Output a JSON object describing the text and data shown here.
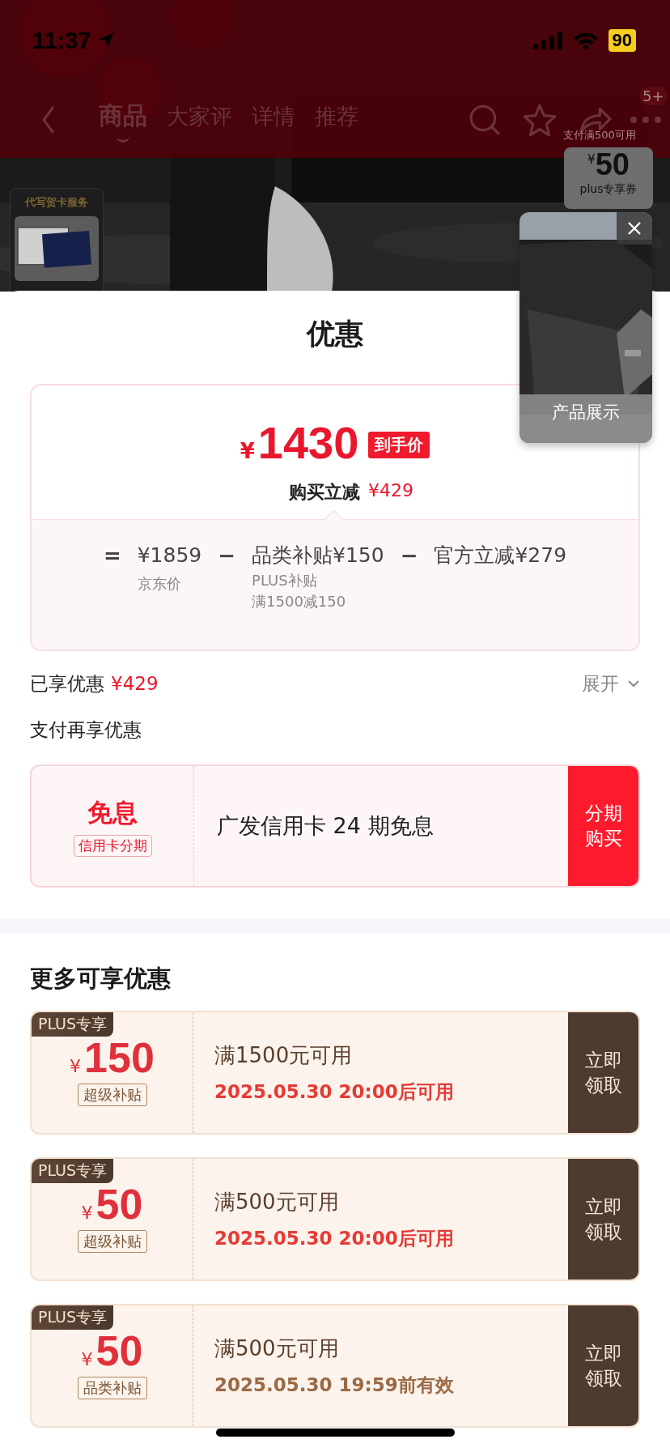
{
  "status_bar": {
    "time": "11:37",
    "battery": "90"
  },
  "nav": {
    "tabs": [
      {
        "label": "商品",
        "selected": true
      },
      {
        "label": "大家评",
        "selected": false
      },
      {
        "label": "详情",
        "selected": false
      },
      {
        "label": "推荐",
        "selected": false
      }
    ],
    "more_badge": "5+"
  },
  "side_promos": {
    "greeting_card": {
      "label": "代写贺卡服务"
    },
    "plus_coupon": {
      "note": "支付满500可用",
      "currency": "¥",
      "amount": "50",
      "label": "plus专享券"
    }
  },
  "video_popup": {
    "label": "产品展示"
  },
  "sheet": {
    "title": "优惠",
    "price_card": {
      "currency": "¥",
      "amount": "1430",
      "tag": "到手价",
      "saving_label": "购买立减",
      "saving_amount": "¥429",
      "breakdown": [
        {
          "kind": "operator",
          "text": "="
        },
        {
          "kind": "term",
          "value": "¥1859",
          "notes": [
            "京东价"
          ]
        },
        {
          "kind": "operator",
          "text": "−"
        },
        {
          "kind": "term",
          "value": "品类补贴¥150",
          "notes": [
            "PLUS补贴",
            "满1500减150"
          ]
        },
        {
          "kind": "operator",
          "text": "−"
        },
        {
          "kind": "term",
          "value": "官方立减¥279"
        }
      ]
    },
    "enjoyed": {
      "label": "已享优惠",
      "amount": "¥429",
      "toggle": "展开"
    },
    "pay_offers": {
      "title": "支付再享优惠",
      "offer": {
        "tag": "免息",
        "subtag": "信用卡分期",
        "text": "广发信用卡 24 期免息",
        "button": "分期购买"
      }
    },
    "more_offers": {
      "title": "更多可享优惠",
      "coupons": [
        {
          "badge": "PLUS专享",
          "currency": "¥",
          "amount": "150",
          "tag": "超级补贴",
          "condition": "满1500元可用",
          "time": "2025.05.30 20:00后可用",
          "time_highlighted": true,
          "button": "立即领取"
        },
        {
          "badge": "PLUS专享",
          "currency": "¥",
          "amount": "50",
          "tag": "超级补贴",
          "condition": "满500元可用",
          "time": "2025.05.30 20:00后可用",
          "time_highlighted": true,
          "button": "立即领取"
        },
        {
          "badge": "PLUS专享",
          "currency": "¥",
          "amount": "50",
          "tag": "品类补贴",
          "condition": "满500元可用",
          "time": "2025.05.30 19:59前有效",
          "time_highlighted": false,
          "button": "立即领取"
        }
      ]
    }
  }
}
